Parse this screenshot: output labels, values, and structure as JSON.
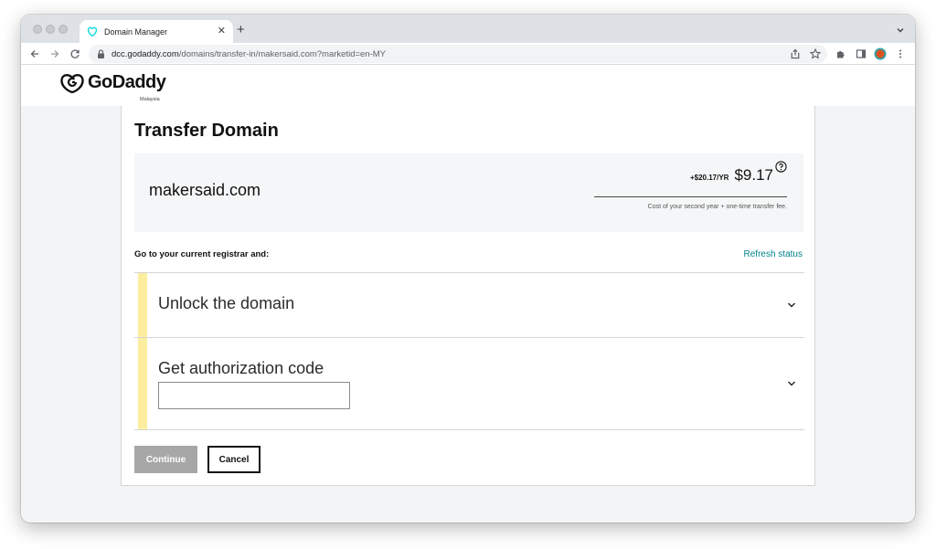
{
  "browser": {
    "tab_title": "Domain Manager",
    "url_host": "dcc.godaddy.com",
    "url_path": "/domains/transfer-in/makersaid.com?marketid=en-MY"
  },
  "header": {
    "logo_text": "GoDaddy",
    "region": "Malaysia"
  },
  "page": {
    "title": "Transfer Domain",
    "domain_name": "makersaid.com",
    "price_old": "+$20.17/YR",
    "price_new": "$9.17",
    "price_note": "Cost of your second year + one-time transfer fee.",
    "instructions": "Go to your current registrar and:",
    "refresh_label": "Refresh status",
    "steps": [
      {
        "title": "Unlock the domain"
      },
      {
        "title": "Get authorization code"
      }
    ],
    "auth_code_value": "",
    "continue_label": "Continue",
    "cancel_label": "Cancel"
  },
  "colors": {
    "accent_link": "#00838c",
    "step_bar": "#fcee9f",
    "continue_disabled": "#a7a7a7"
  },
  "icons": [
    "godaddy-favicon-icon",
    "close-icon",
    "plus-icon",
    "chevron-down-icon",
    "back-arrow-icon",
    "forward-arrow-icon",
    "reload-icon",
    "lock-icon",
    "share-icon",
    "star-icon",
    "extensions-icon",
    "sidepanel-icon",
    "profile-avatar-icon",
    "kebab-menu-icon",
    "godaddy-logo-icon",
    "help-circle-icon"
  ]
}
